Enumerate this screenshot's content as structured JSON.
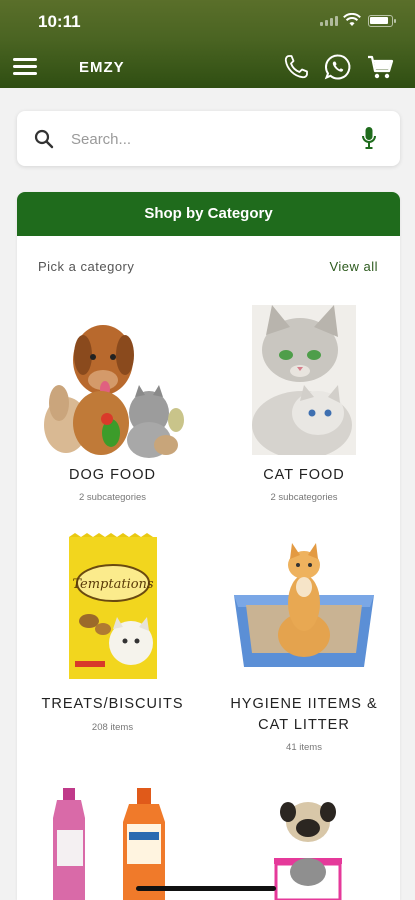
{
  "status_bar": {
    "time": "10:11"
  },
  "header": {
    "brand": "EMZY",
    "icons": [
      "menu-icon",
      "phone-icon",
      "whatsapp-icon",
      "cart-icon"
    ]
  },
  "search": {
    "placeholder": "Search...",
    "value": ""
  },
  "category_card": {
    "title": "Shop by Category",
    "pick_label": "Pick a category",
    "view_all": "View all",
    "items": [
      {
        "name": "DOG FOOD",
        "subtitle": "2 subcategories"
      },
      {
        "name": "CAT FOOD",
        "subtitle": "2 subcategories"
      },
      {
        "name": "TREATS/BISCUITS",
        "subtitle": "208 items"
      },
      {
        "name": "HYGIENE IITEMS & CAT LITTER",
        "subtitle": "41 items"
      }
    ]
  },
  "colors": {
    "header_green": "#3f5d1c",
    "card_header_green": "#1f6b1c",
    "accent_green": "#2c5a1d"
  }
}
